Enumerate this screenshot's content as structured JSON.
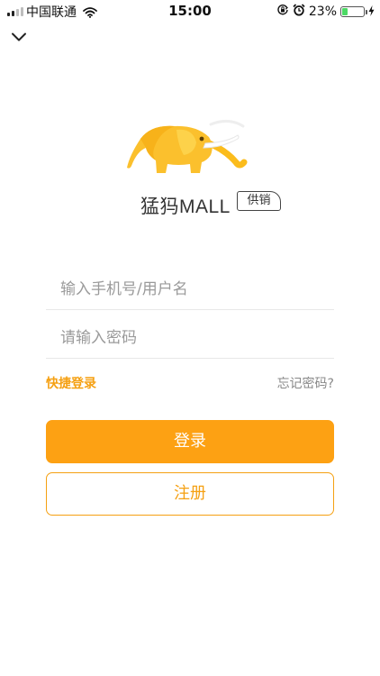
{
  "status_bar": {
    "carrier": "中国联通",
    "time": "15:00",
    "battery_percent": "23%",
    "battery_level": 0.23,
    "icons": [
      "signal-icon",
      "wifi-icon",
      "orientation-lock-icon",
      "alarm-icon",
      "battery-icon",
      "charging-icon"
    ]
  },
  "header": {
    "close_icon": "chevron-down-icon"
  },
  "logo": {
    "brand_name": "猛犸MALL",
    "tag": "供销",
    "mascot": "elephant-logo"
  },
  "form": {
    "phone_placeholder": "输入手机号/用户名",
    "password_placeholder": "请输入密码",
    "quick_login": "快捷登录",
    "forgot_password": "忘记密码?",
    "login_button": "登录",
    "register_button": "注册"
  },
  "colors": {
    "accent": "#fda113",
    "accent_text": "#f5a012",
    "placeholder": "#9a9a9a",
    "battery_fill": "#4cd964"
  }
}
